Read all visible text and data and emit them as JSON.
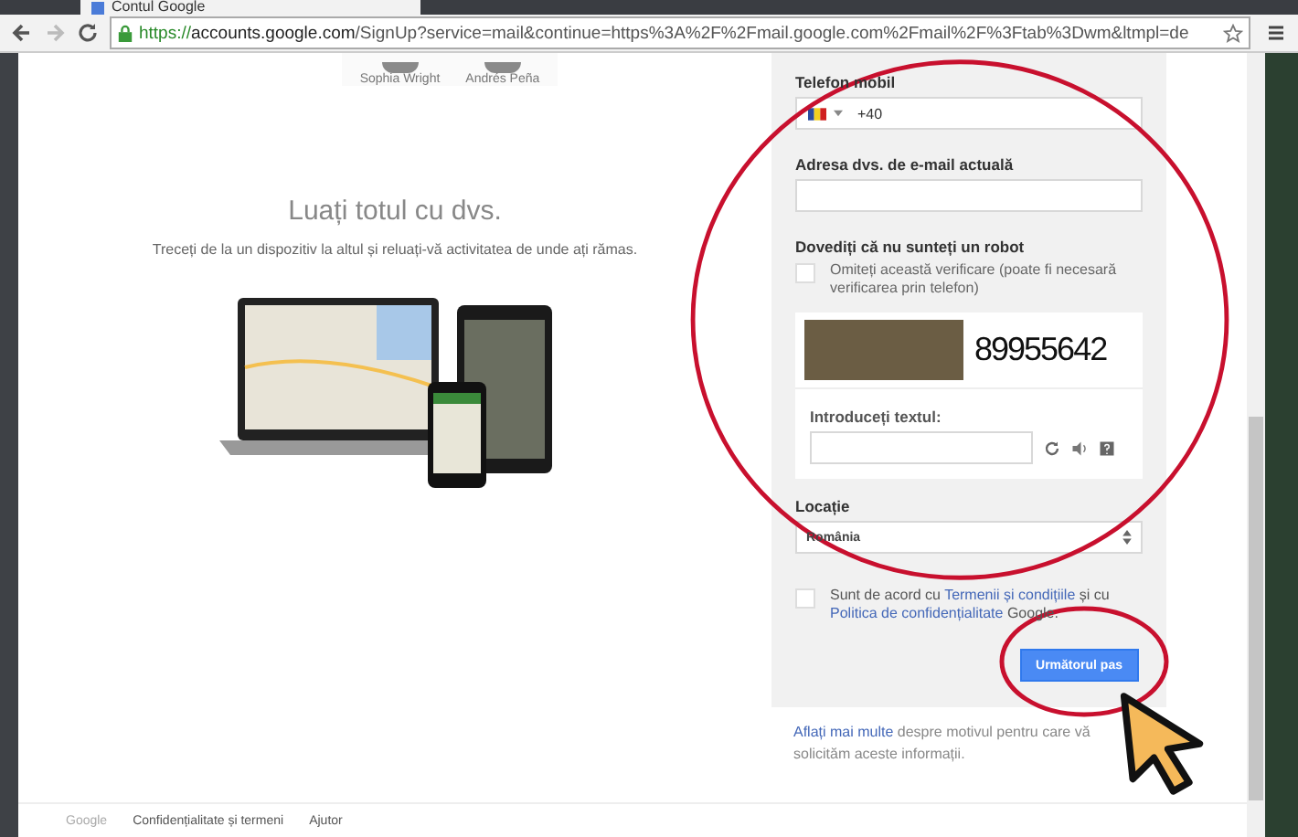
{
  "browser": {
    "tab_title": "Contul Google",
    "url_scheme": "https://",
    "url_host": "accounts.google.com",
    "url_path": "/SignUp?service=mail&continue=https%3A%2F%2Fmail.google.com%2Fmail%2F%3Ftab%3Dwm&ltmpl=de"
  },
  "people": [
    "Sophia Wright",
    "Andrés Peña"
  ],
  "promo": {
    "title": "Luați totul cu dvs.",
    "subtitle": "Treceți de la un dispozitiv la altul și reluați-vă activitatea de unde ați rămas."
  },
  "form": {
    "phone_label": "Telefon mobil",
    "phone_value": "+40",
    "email_label": "Adresa dvs. de e-mail actuală",
    "robot_label": "Dovediți că nu sunteți un robot",
    "skip_check": {
      "label": "Omiteți această verificare (poate fi necesară verificarea prin telefon)",
      "checked": false
    },
    "captcha": {
      "text": "89955642",
      "input_label": "Introduceți textul:"
    },
    "location_label": "Locație",
    "location_value": "România",
    "terms": {
      "checked": false,
      "before": "Sunt de acord cu ",
      "link1": "Termenii și condițiile",
      "middle": " și cu ",
      "link2": "Politica de confidențialitate",
      "after": " Google."
    },
    "next_button": "Următorul pas"
  },
  "info": {
    "link": "Aflați mai multe",
    "text": " despre motivul pentru care vă solicităm aceste informații."
  },
  "footer": [
    "Google",
    "Confidențialitate și termeni",
    "Ajutor"
  ]
}
